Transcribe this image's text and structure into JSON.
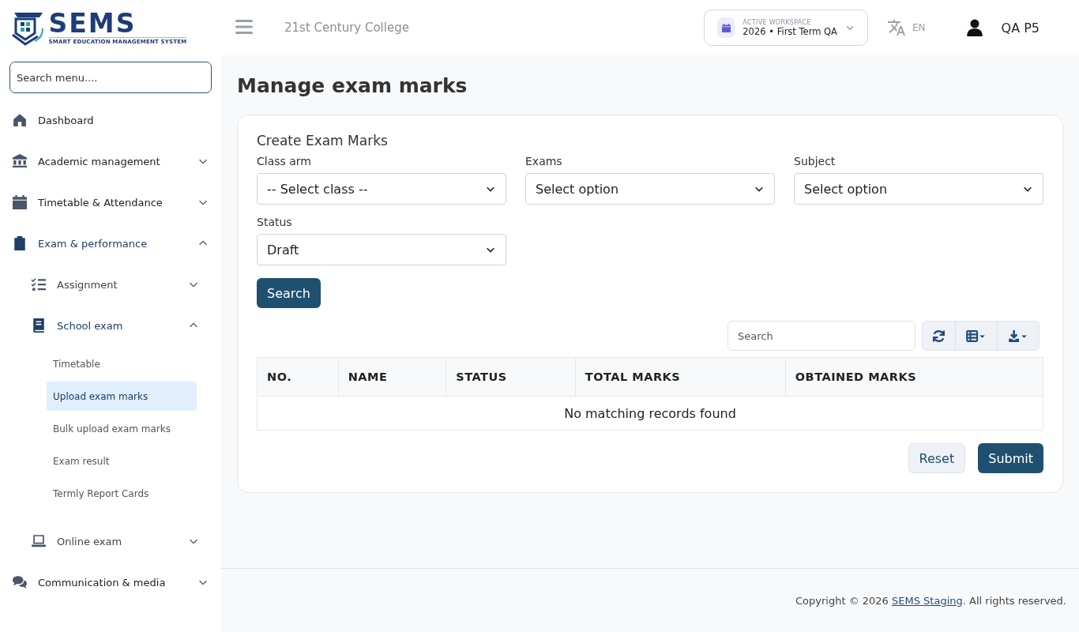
{
  "logo": {
    "name": "SEMS",
    "tagline": "SMART EDUCATION MANAGEMENT SYSTEM"
  },
  "header": {
    "school": "21st Century College",
    "workspace": {
      "label": "ACTIVE WORKSPACE",
      "value": "2026 • First Term QA"
    },
    "language": "EN",
    "user": "QA P5"
  },
  "sidebar": {
    "search": {
      "placeholder": "Search menu...."
    },
    "items": [
      {
        "label": "Dashboard",
        "selected": false
      },
      {
        "label": "Academic management",
        "selected": false,
        "expanded": false
      },
      {
        "label": "Timetable & Attendance",
        "selected": false,
        "expanded": false
      },
      {
        "label": "Exam & performance",
        "selected": true,
        "expanded": true,
        "children": [
          {
            "label": "Assignment",
            "selected": false,
            "expanded": false
          },
          {
            "label": "School exam",
            "selected": true,
            "expanded": true,
            "children": [
              {
                "label": "Timetable",
                "selected": false
              },
              {
                "label": "Upload exam marks",
                "selected": true
              },
              {
                "label": "Bulk upload exam marks",
                "selected": false
              },
              {
                "label": "Exam result",
                "selected": false
              },
              {
                "label": "Termly Report Cards",
                "selected": false
              }
            ]
          },
          {
            "label": "Online exam",
            "selected": false,
            "expanded": false
          }
        ]
      },
      {
        "label": "Communication & media",
        "selected": false,
        "expanded": false
      }
    ]
  },
  "page": {
    "title": "Manage exam marks",
    "card_title": "Create Exam Marks",
    "fields": [
      {
        "label": "Class arm",
        "value": "-- Select class --"
      },
      {
        "label": "Exams",
        "value": "Select option"
      },
      {
        "label": "Subject",
        "value": "Select option"
      },
      {
        "label": "Status",
        "value": "Draft"
      }
    ],
    "search_button": "Search",
    "table": {
      "search": {
        "placeholder": "Search"
      },
      "columns": [
        "NO.",
        "NAME",
        "STATUS",
        "TOTAL MARKS",
        "OBTAINED MARKS"
      ],
      "empty": "No matching records found"
    },
    "buttons": [
      {
        "label": "Reset",
        "kind": "secondary"
      },
      {
        "label": "Submit",
        "kind": "primary"
      }
    ]
  },
  "footer": {
    "before": "Copyright © 2026 ",
    "link": "SEMS Staging",
    "after": ". All rights reserved."
  }
}
